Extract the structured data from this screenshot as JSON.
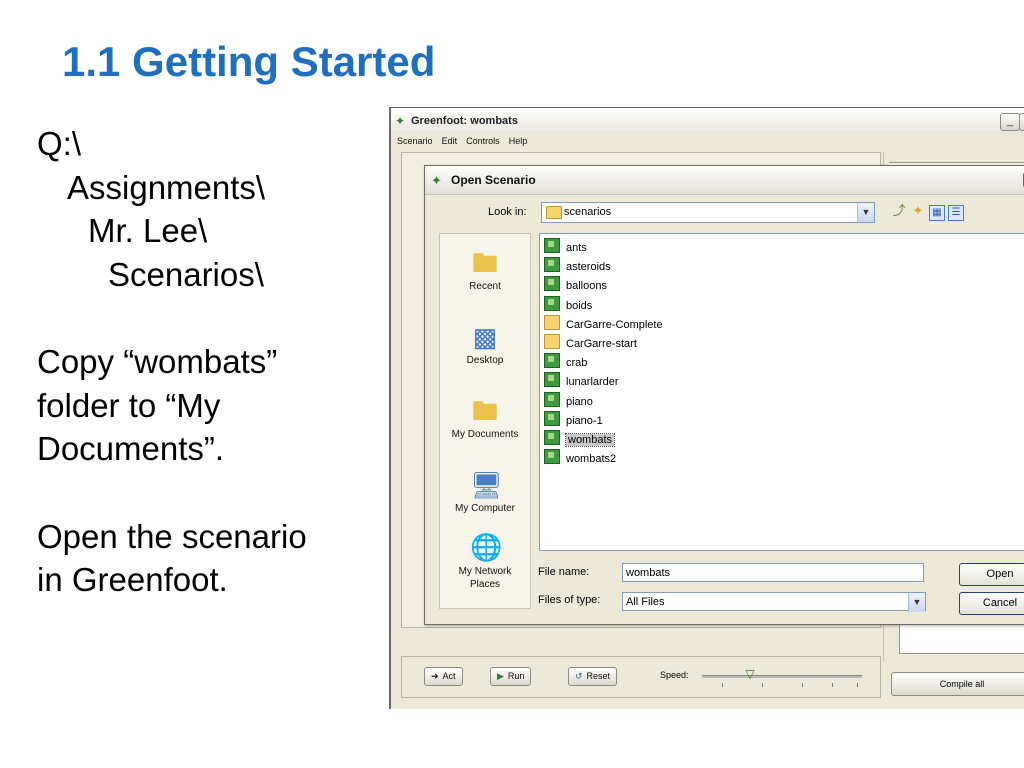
{
  "slide": {
    "title": "1.1 Getting Started",
    "path_lines": [
      "Q:\\",
      "Assignments\\",
      "Mr. Lee\\",
      "Scenarios\\"
    ],
    "para1": [
      "Copy “wombats”",
      "folder to “My",
      "Documents”."
    ],
    "para2": [
      "Open the scenario",
      "in Greenfoot."
    ]
  },
  "window": {
    "title": "Greenfoot: wombats",
    "icon": "greenfoot-icon",
    "menu": [
      "Scenario",
      "Edit",
      "Controls",
      "Help"
    ],
    "min_glyph": "_",
    "max_glyph": "□"
  },
  "dialog": {
    "title": "Open Scenario",
    "look_in_label": "Look in:",
    "look_in_value": "scenarios",
    "places": [
      "Recent",
      "Desktop",
      "My Documents",
      "My Computer",
      "My Network Places"
    ],
    "files": [
      {
        "name": "ants",
        "kind": "scenario"
      },
      {
        "name": "asteroids",
        "kind": "scenario"
      },
      {
        "name": "balloons",
        "kind": "scenario"
      },
      {
        "name": "boids",
        "kind": "scenario"
      },
      {
        "name": "CarGarre-Complete",
        "kind": "folder"
      },
      {
        "name": "CarGarre-start",
        "kind": "folder"
      },
      {
        "name": "crab",
        "kind": "scenario"
      },
      {
        "name": "lunarlarder",
        "kind": "scenario"
      },
      {
        "name": "piano",
        "kind": "scenario"
      },
      {
        "name": "piano-1",
        "kind": "scenario"
      },
      {
        "name": "wombats",
        "kind": "scenario",
        "selected": true
      },
      {
        "name": "wombats2",
        "kind": "scenario"
      }
    ],
    "file_name_label": "File name:",
    "file_name_value": "wombats",
    "files_of_type_label": "Files of type:",
    "files_of_type_value": "All Files",
    "open_label": "Open",
    "cancel_label": "Cancel"
  },
  "controls": {
    "act_label": "Act",
    "run_label": "Run",
    "reset_label": "Reset",
    "speed_label": "Speed:",
    "speed_fraction": 0.3,
    "compile_label": "Compile all"
  },
  "colors": {
    "title_blue": "#1f6fbf",
    "selection": "#c9c9c9",
    "xp_face": "#ece9d8"
  }
}
